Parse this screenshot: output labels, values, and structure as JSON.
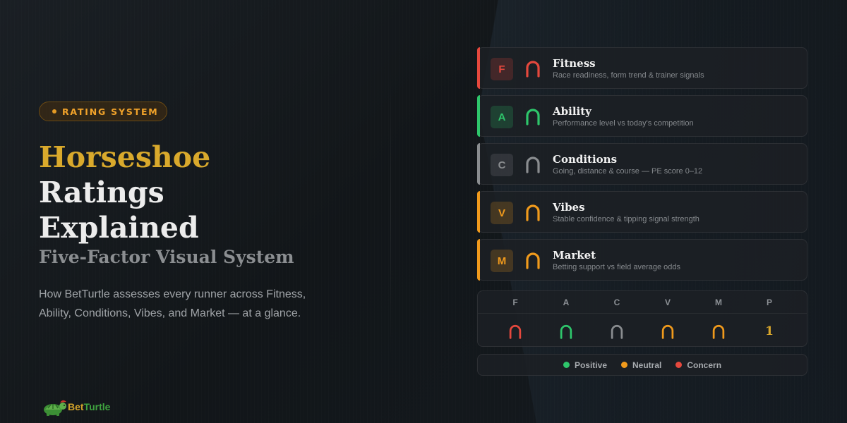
{
  "badge": {
    "label": "RATING SYSTEM"
  },
  "title": {
    "line1": "Horseshoe",
    "line2": "Ratings",
    "line3": "Explained"
  },
  "subtitle": "Five-Factor Visual System",
  "description": "How BetTurtle assesses every runner across Fitness, Ability, Conditions, Vibes, and Market — at a glance.",
  "brand": {
    "part1": "Bet",
    "part2": "Turtle"
  },
  "colors": {
    "positive": "#2ec66b",
    "neutral": "#f09a1c",
    "concern": "#e5483d",
    "unrated": "#8a8d90",
    "gold": "#d9a92c"
  },
  "factors": [
    {
      "letter": "F",
      "name": "Fitness",
      "description": "Race readiness, form trend & trainer signals",
      "status": "concern"
    },
    {
      "letter": "A",
      "name": "Ability",
      "description": "Performance level vs today's competition",
      "status": "positive"
    },
    {
      "letter": "C",
      "name": "Conditions",
      "description": "Going, distance & course — PE score 0–12",
      "status": "unrated"
    },
    {
      "letter": "V",
      "name": "Vibes",
      "description": "Stable confidence & tipping signal strength",
      "status": "neutral"
    },
    {
      "letter": "M",
      "name": "Market",
      "description": "Betting support vs field average odds",
      "status": "neutral"
    }
  ],
  "summary": {
    "headers": [
      "F",
      "A",
      "C",
      "V",
      "M",
      "P"
    ],
    "statuses": [
      "concern",
      "positive",
      "unrated",
      "neutral",
      "neutral"
    ],
    "position_value": "1"
  },
  "legend": [
    {
      "label": "Positive",
      "status": "positive"
    },
    {
      "label": "Neutral",
      "status": "neutral"
    },
    {
      "label": "Concern",
      "status": "concern"
    }
  ]
}
